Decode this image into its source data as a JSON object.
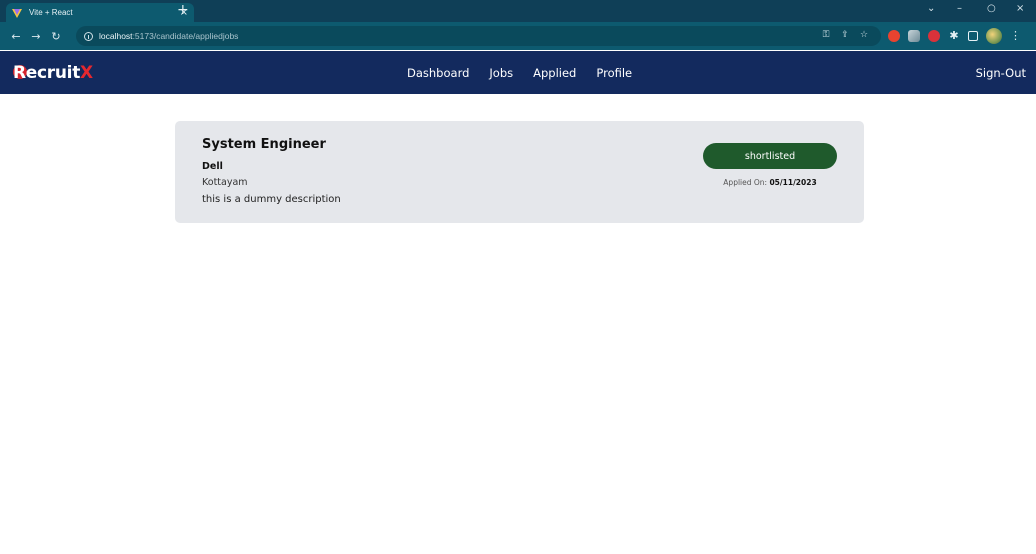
{
  "browser": {
    "tab_title": "Vite + React",
    "tab_close": "×",
    "new_tab": "+",
    "url_host": "localhost",
    "url_path": ":5173/candidate/appliedjobs",
    "controls": {
      "chevron": "⌄",
      "minimize": "–",
      "maximize": "○",
      "close": "×"
    },
    "nav": {
      "back": "←",
      "forward": "→",
      "reload": "↻"
    }
  },
  "app": {
    "logo_main": "Recruit",
    "logo_accent": "X",
    "nav_links": [
      "Dashboard",
      "Jobs",
      "Applied",
      "Profile"
    ],
    "signout": "Sign-Out"
  },
  "applied_jobs": [
    {
      "title": "System Engineer",
      "company": "Dell",
      "location": "Kottayam",
      "description": "this is a dummy description",
      "status": "shortlisted",
      "applied_label": "Applied On: ",
      "applied_date": "05/11/2023"
    }
  ],
  "colors": {
    "navbar": "#132a5e",
    "status_shortlisted": "#1f5a2c",
    "card_bg": "#e5e7eb",
    "logo_accent": "#e5282f"
  }
}
